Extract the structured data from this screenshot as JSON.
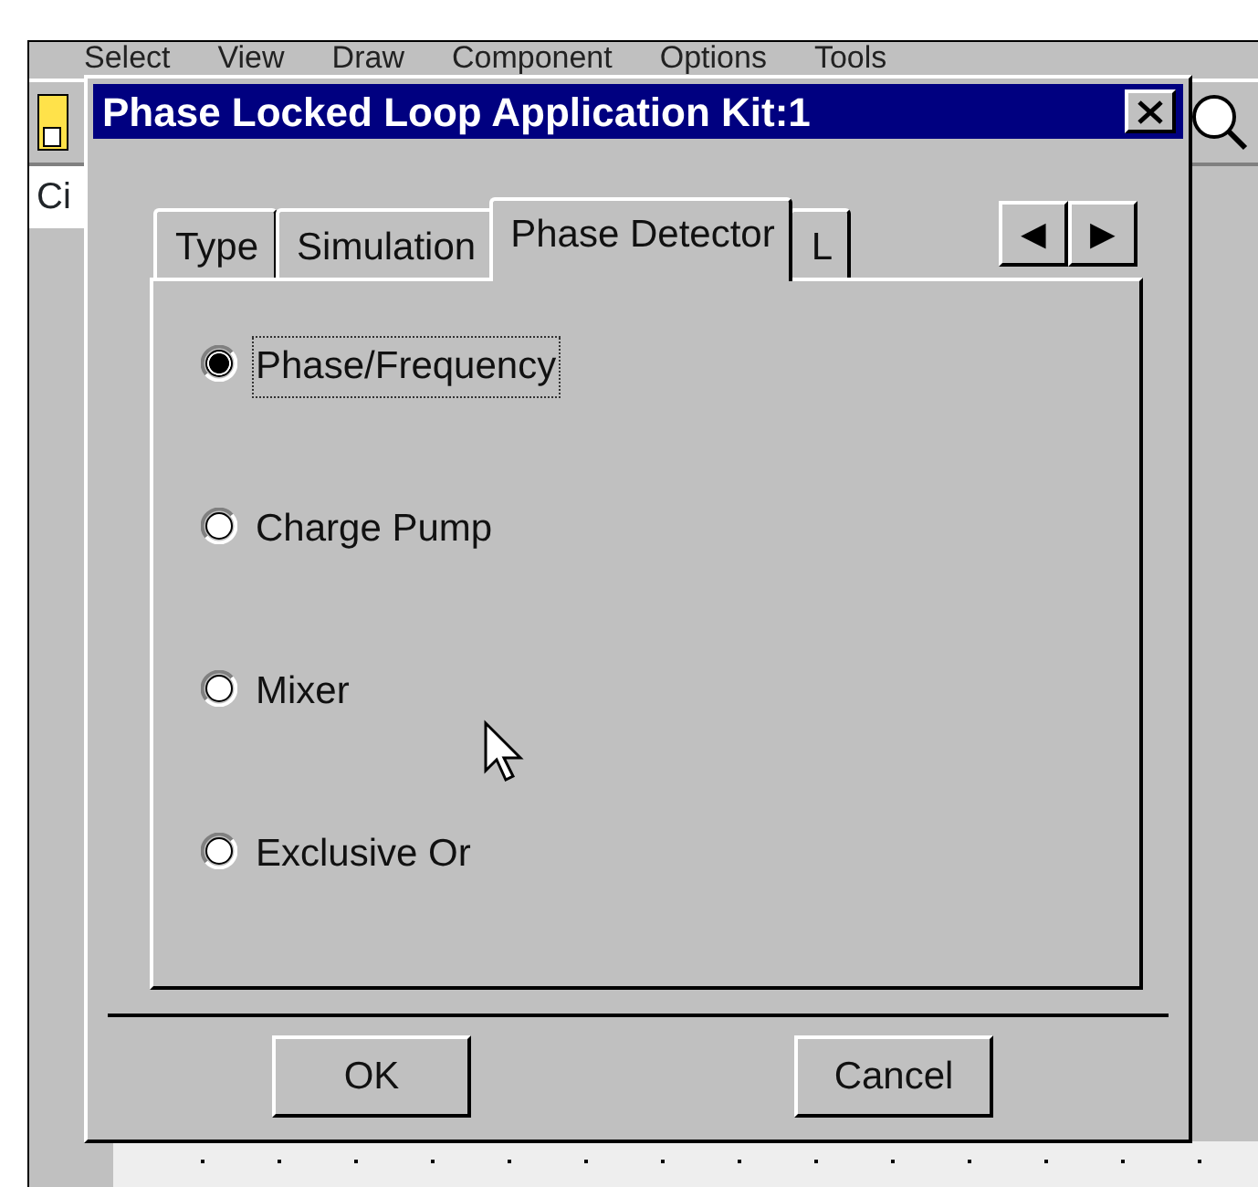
{
  "app": {
    "menu": [
      "Select",
      "View",
      "Draw",
      "Component",
      "Options",
      "Tools"
    ],
    "side_label": "Ci"
  },
  "dialog": {
    "title": "Phase Locked Loop Application Kit:1",
    "tabs": [
      {
        "label": "Type",
        "selected": false
      },
      {
        "label": "Simulation",
        "selected": false
      },
      {
        "label": "Phase Detector",
        "selected": true
      },
      {
        "label": "L",
        "selected": false
      }
    ],
    "tab_scroll": [
      "◀",
      "▶"
    ],
    "options": [
      {
        "label": "Phase/Frequency",
        "selected": true,
        "focused": true
      },
      {
        "label": "Charge Pump",
        "selected": false,
        "focused": false
      },
      {
        "label": "Mixer",
        "selected": false,
        "focused": false
      },
      {
        "label": "Exclusive Or",
        "selected": false,
        "focused": false
      }
    ],
    "buttons": [
      "OK",
      "Cancel"
    ]
  }
}
